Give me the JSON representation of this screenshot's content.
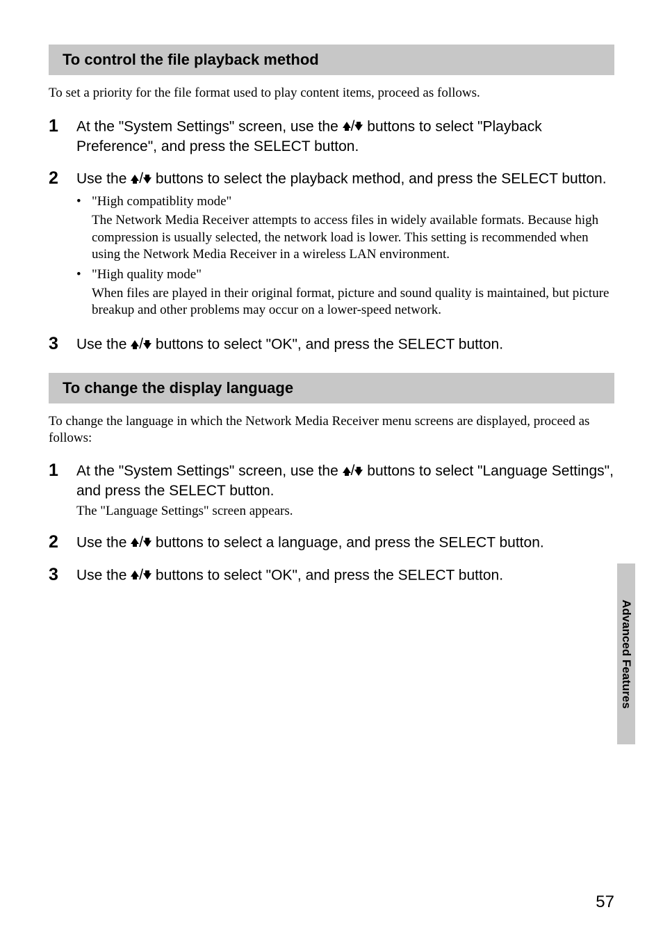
{
  "section1": {
    "heading": "To control the file playback method",
    "intro": "To set a priority for the file format used to play content items, proceed as follows.",
    "steps": [
      {
        "num": "1",
        "text_pre": "At the \"System Settings\" screen, use the ",
        "text_post": " buttons to select \"Playback Preference\", and press the SELECT button."
      },
      {
        "num": "2",
        "text_pre": "Use the ",
        "text_post": " buttons to select the playback method, and press the SELECT button.",
        "bullets": [
          {
            "intro": "\"High compatiblity mode\"",
            "body": "The Network Media Receiver attempts to access files in widely available formats. Because high compression is usually selected, the network load is lower. This setting is recommended when using the Network Media Receiver in a wireless LAN environment."
          },
          {
            "intro": "\"High quality mode\"",
            "body": "When files are played in their original format, picture and sound quality is maintained, but picture breakup and other problems may occur on a lower-speed network."
          }
        ]
      },
      {
        "num": "3",
        "text_pre": "Use the ",
        "text_post": " buttons to select \"OK\", and press the SELECT button."
      }
    ]
  },
  "section2": {
    "heading": "To change the display language",
    "intro": "To change the language in which the Network Media Receiver menu screens are displayed, proceed as follows:",
    "steps": [
      {
        "num": "1",
        "text_pre": "At the \"System Settings\" screen, use the ",
        "text_post": " buttons to select \"Language Settings\", and press the SELECT button.",
        "note": "The \"Language Settings\" screen appears."
      },
      {
        "num": "2",
        "text_pre": "Use the ",
        "text_post": " buttons to select a language, and press the SELECT button."
      },
      {
        "num": "3",
        "text_pre": "Use the ",
        "text_post": " buttons to select \"OK\", and press the SELECT button."
      }
    ]
  },
  "sidetab": "Advanced Features",
  "page_number": "57",
  "arrow_sep": "/"
}
